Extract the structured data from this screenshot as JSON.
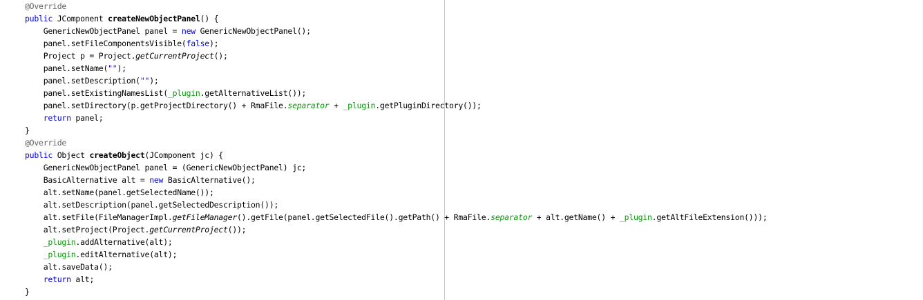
{
  "editor": {
    "language": "Java",
    "colors": {
      "background": "#ffffff",
      "keyword": "#0000e6",
      "string": "#2a00ff",
      "field": "#0a9a0a",
      "annotation": "#646464",
      "text": "#000000",
      "margin_line": "#e8b4c8"
    },
    "lines": [
      [
        {
          "t": "@Override",
          "s": "ann"
        }
      ],
      [
        {
          "t": "public",
          "s": "kw"
        },
        {
          "t": " JComponent ",
          "s": "plain"
        },
        {
          "t": "createNewObjectPanel",
          "s": "bold"
        },
        {
          "t": "() {",
          "s": "plain"
        }
      ],
      [
        {
          "t": "    GenericNewObjectPanel panel = ",
          "s": "plain"
        },
        {
          "t": "new",
          "s": "kw"
        },
        {
          "t": " GenericNewObjectPanel();",
          "s": "plain"
        }
      ],
      [
        {
          "t": "    panel.setFileComponentsVisible(",
          "s": "plain"
        },
        {
          "t": "false",
          "s": "kw"
        },
        {
          "t": ");",
          "s": "plain"
        }
      ],
      [
        {
          "t": "    Project p = Project.",
          "s": "plain"
        },
        {
          "t": "getCurrentProject",
          "s": "italic"
        },
        {
          "t": "();",
          "s": "plain"
        }
      ],
      [
        {
          "t": "    panel.setName(",
          "s": "plain"
        },
        {
          "t": "\"\"",
          "s": "str"
        },
        {
          "t": ");",
          "s": "plain"
        }
      ],
      [
        {
          "t": "    panel.setDescription(",
          "s": "plain"
        },
        {
          "t": "\"\"",
          "s": "str"
        },
        {
          "t": ");",
          "s": "plain"
        }
      ],
      [
        {
          "t": "    panel.setExistingNamesList(",
          "s": "plain"
        },
        {
          "t": "_plugin",
          "s": "field"
        },
        {
          "t": ".getAlternativeList());",
          "s": "plain"
        }
      ],
      [
        {
          "t": "    panel.setDirectory(p.getProjectDirectory() + RmaFile.",
          "s": "plain"
        },
        {
          "t": "separator",
          "s": "fielditalic"
        },
        {
          "t": " + ",
          "s": "plain"
        },
        {
          "t": "_plugin",
          "s": "field"
        },
        {
          "t": ".getPluginDirectory());",
          "s": "plain"
        }
      ],
      [
        {
          "t": "    ",
          "s": "plain"
        },
        {
          "t": "return",
          "s": "kw"
        },
        {
          "t": " panel;",
          "s": "plain"
        }
      ],
      [
        {
          "t": "}",
          "s": "plain"
        }
      ],
      [
        {
          "t": "@Override",
          "s": "ann"
        }
      ],
      [
        {
          "t": "public",
          "s": "kw"
        },
        {
          "t": " Object ",
          "s": "plain"
        },
        {
          "t": "createObject",
          "s": "bold"
        },
        {
          "t": "(JComponent jc) {",
          "s": "plain"
        }
      ],
      [
        {
          "t": "    GenericNewObjectPanel panel = (GenericNewObjectPanel) jc;",
          "s": "plain"
        }
      ],
      [
        {
          "t": "    BasicAlternative alt = ",
          "s": "plain"
        },
        {
          "t": "new",
          "s": "kw"
        },
        {
          "t": " BasicAlternative();",
          "s": "plain"
        }
      ],
      [
        {
          "t": "    alt.setName(panel.getSelectedName());",
          "s": "plain"
        }
      ],
      [
        {
          "t": "    alt.setDescription(panel.getSelectedDescription());",
          "s": "plain"
        }
      ],
      [
        {
          "t": "    alt.setFile(FileManagerImpl.",
          "s": "plain"
        },
        {
          "t": "getFileManager",
          "s": "italic"
        },
        {
          "t": "().getFile(panel.getSelectedFile().getPath() + RmaFile.",
          "s": "plain"
        },
        {
          "t": "separator",
          "s": "fielditalic"
        },
        {
          "t": " + alt.getName() + ",
          "s": "plain"
        },
        {
          "t": "_plugin",
          "s": "field"
        },
        {
          "t": ".getAltFileExtension()));",
          "s": "plain"
        }
      ],
      [
        {
          "t": "    alt.setProject(Project.",
          "s": "plain"
        },
        {
          "t": "getCurrentProject",
          "s": "italic"
        },
        {
          "t": "());",
          "s": "plain"
        }
      ],
      [
        {
          "t": "    ",
          "s": "plain"
        },
        {
          "t": "_plugin",
          "s": "field"
        },
        {
          "t": ".addAlternative(alt);",
          "s": "plain"
        }
      ],
      [
        {
          "t": "    ",
          "s": "plain"
        },
        {
          "t": "_plugin",
          "s": "field"
        },
        {
          "t": ".editAlternative(alt);",
          "s": "plain"
        }
      ],
      [
        {
          "t": "    alt.saveData();",
          "s": "plain"
        }
      ],
      [
        {
          "t": "    ",
          "s": "plain"
        },
        {
          "t": "return",
          "s": "kw"
        },
        {
          "t": " alt;",
          "s": "plain"
        }
      ],
      [
        {
          "t": "}",
          "s": "plain"
        }
      ]
    ]
  }
}
